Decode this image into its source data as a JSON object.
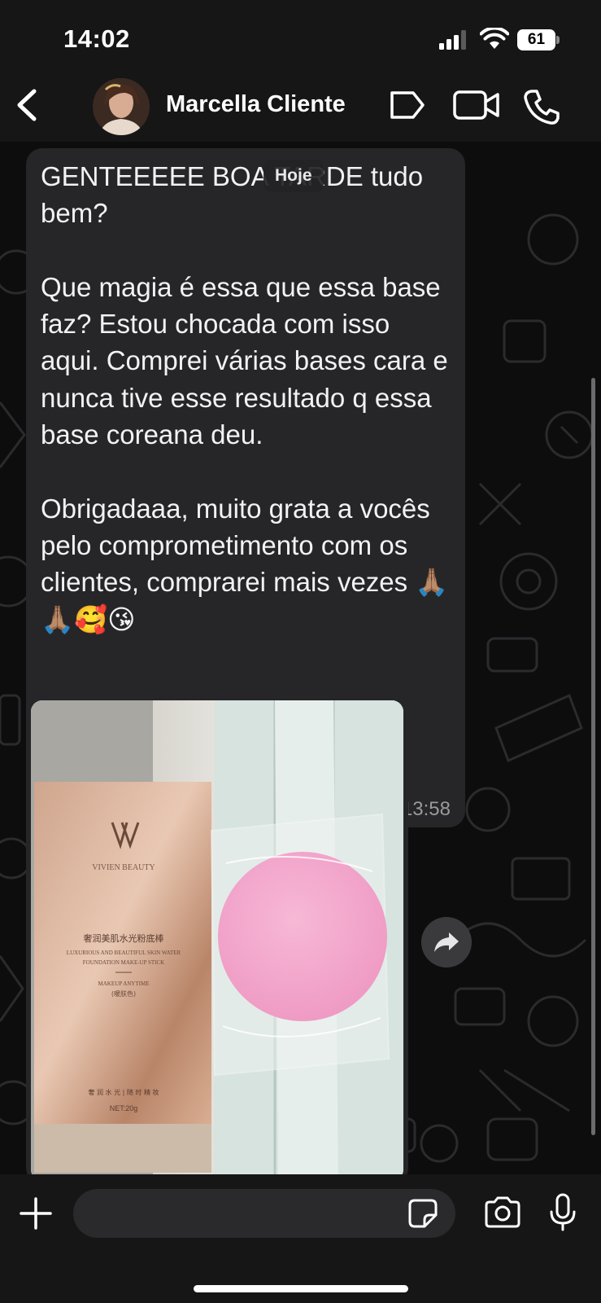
{
  "status_bar": {
    "time": "14:02",
    "battery_level": "61",
    "signal_icon": "cellular-signal-icon",
    "wifi_icon": "wifi-icon"
  },
  "header": {
    "back_icon": "chevron-left-icon",
    "contact_name": "Marcella Cliente",
    "label_icon": "tag-icon",
    "video_icon": "video-camera-icon",
    "call_icon": "phone-icon"
  },
  "chat": {
    "date_separator": "Hoje",
    "messages": [
      {
        "text": "GENTEEEEE BOA TARDE tudo bem?\n\nQue magia é essa que essa base faz? Estou chocada com isso aqui. Comprei várias bases cara e nunca tive esse resultado q essa base coreana deu.\n\nObrigadaaa, muito grata a vocês pelo comprometimento com os clientes, comprarei mais vezes 🙏🏽🙏🏽🥰😘",
        "time": "13:58"
      }
    ],
    "photo": {
      "brand": "VIVIEN BEAUTY",
      "logo": "VV",
      "chinese_title": "奢润美肌水光粉底棒",
      "english_line1": "LUXURIOUS AND BEAUTIFUL SKIN WATER",
      "english_line2": "FOUNDATION MAKE-UP STICK",
      "shade_line1": "MAKEUP ANYTIME",
      "shade_line2": "(暖肤色)",
      "bottom_line": "奢 润 水 光 | 随 时 精 妆",
      "net_weight": "NET:20g"
    },
    "forward_icon": "forward-arrow-icon"
  },
  "input_bar": {
    "plus_icon": "plus-icon",
    "placeholder": "",
    "sticker_icon": "sticker-icon",
    "camera_icon": "camera-icon",
    "mic_icon": "microphone-icon"
  }
}
